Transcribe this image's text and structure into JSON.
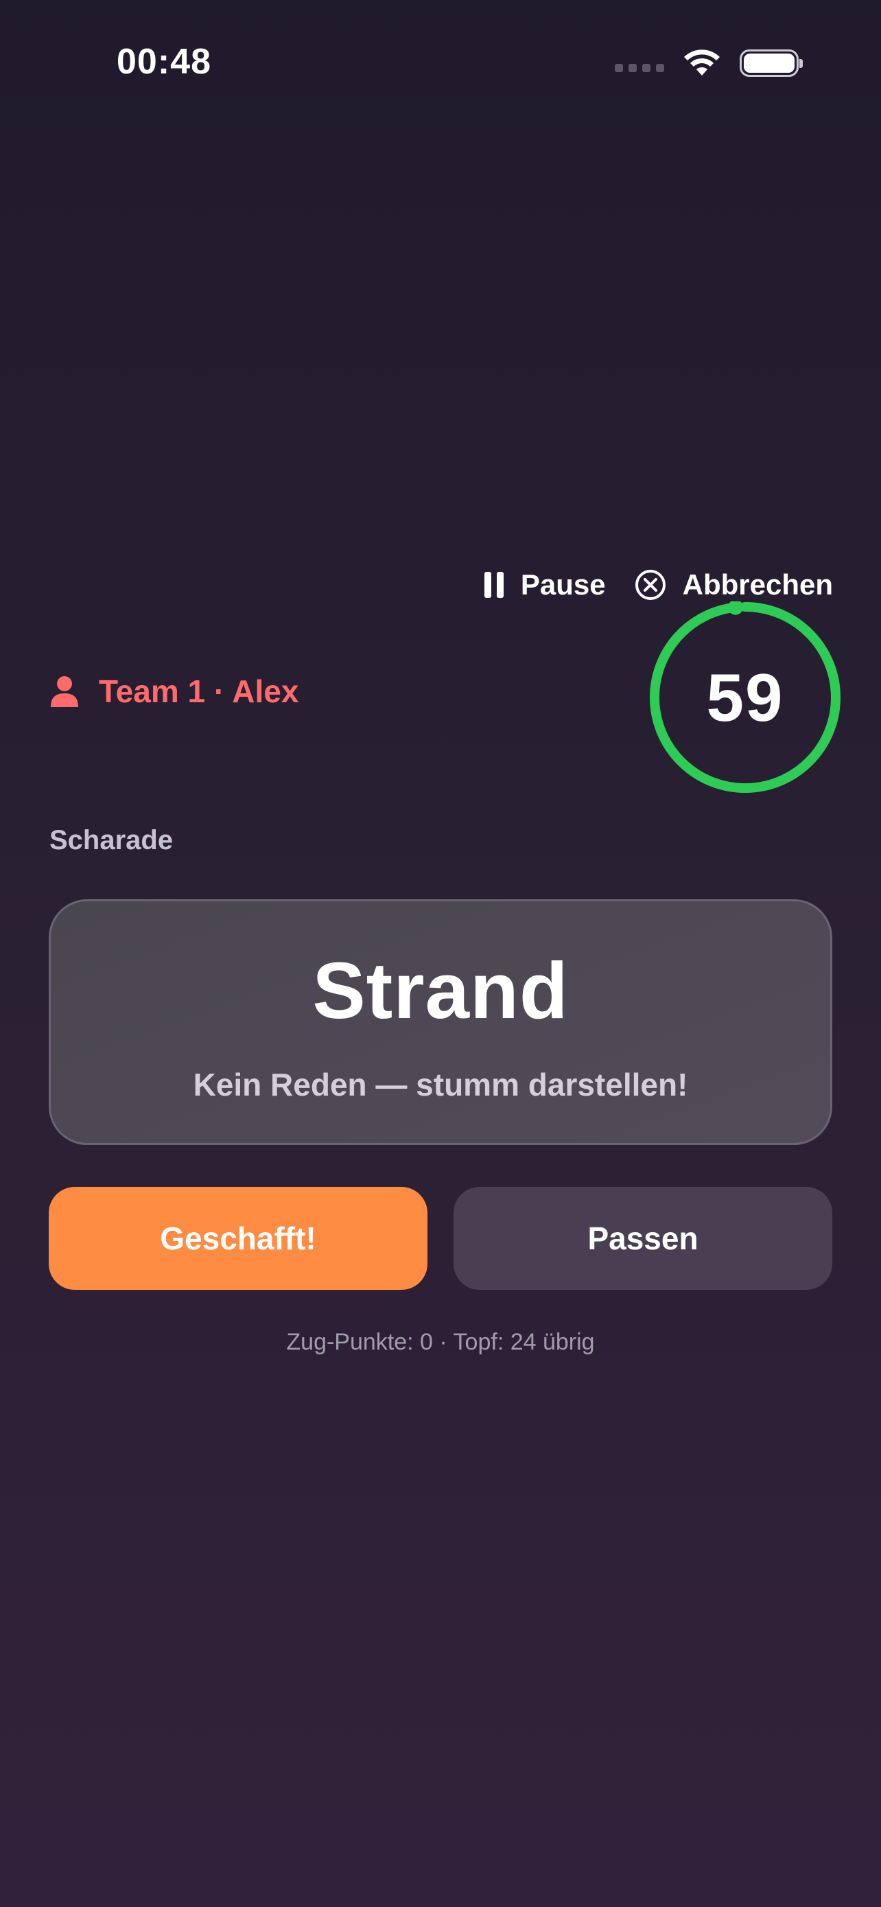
{
  "status_bar": {
    "time": "00:48"
  },
  "controls": {
    "pause_label": "Pause",
    "cancel_label": "Abbrechen"
  },
  "player": {
    "label": "Team 1 · Alex",
    "color": "#ff6b6b"
  },
  "timer": {
    "value": "59",
    "remaining_fraction": 0.983,
    "ring_color": "#2ecc55"
  },
  "category": {
    "label": "Scharade"
  },
  "card": {
    "word": "Strand",
    "hint": "Kein Reden — stumm darstellen!"
  },
  "actions": {
    "success_label": "Geschafft!",
    "success_color": "#ff8c42",
    "pass_label": "Passen",
    "pass_color": "#4a3f52"
  },
  "footer": {
    "info": "Zug-Punkte: 0 · Topf: 24 übrig"
  },
  "icons": {
    "pause": "pause-icon",
    "cancel": "close-circle-icon",
    "player": "person-icon",
    "wifi": "wifi-icon",
    "battery": "battery-icon",
    "signal": "signal-icon"
  }
}
